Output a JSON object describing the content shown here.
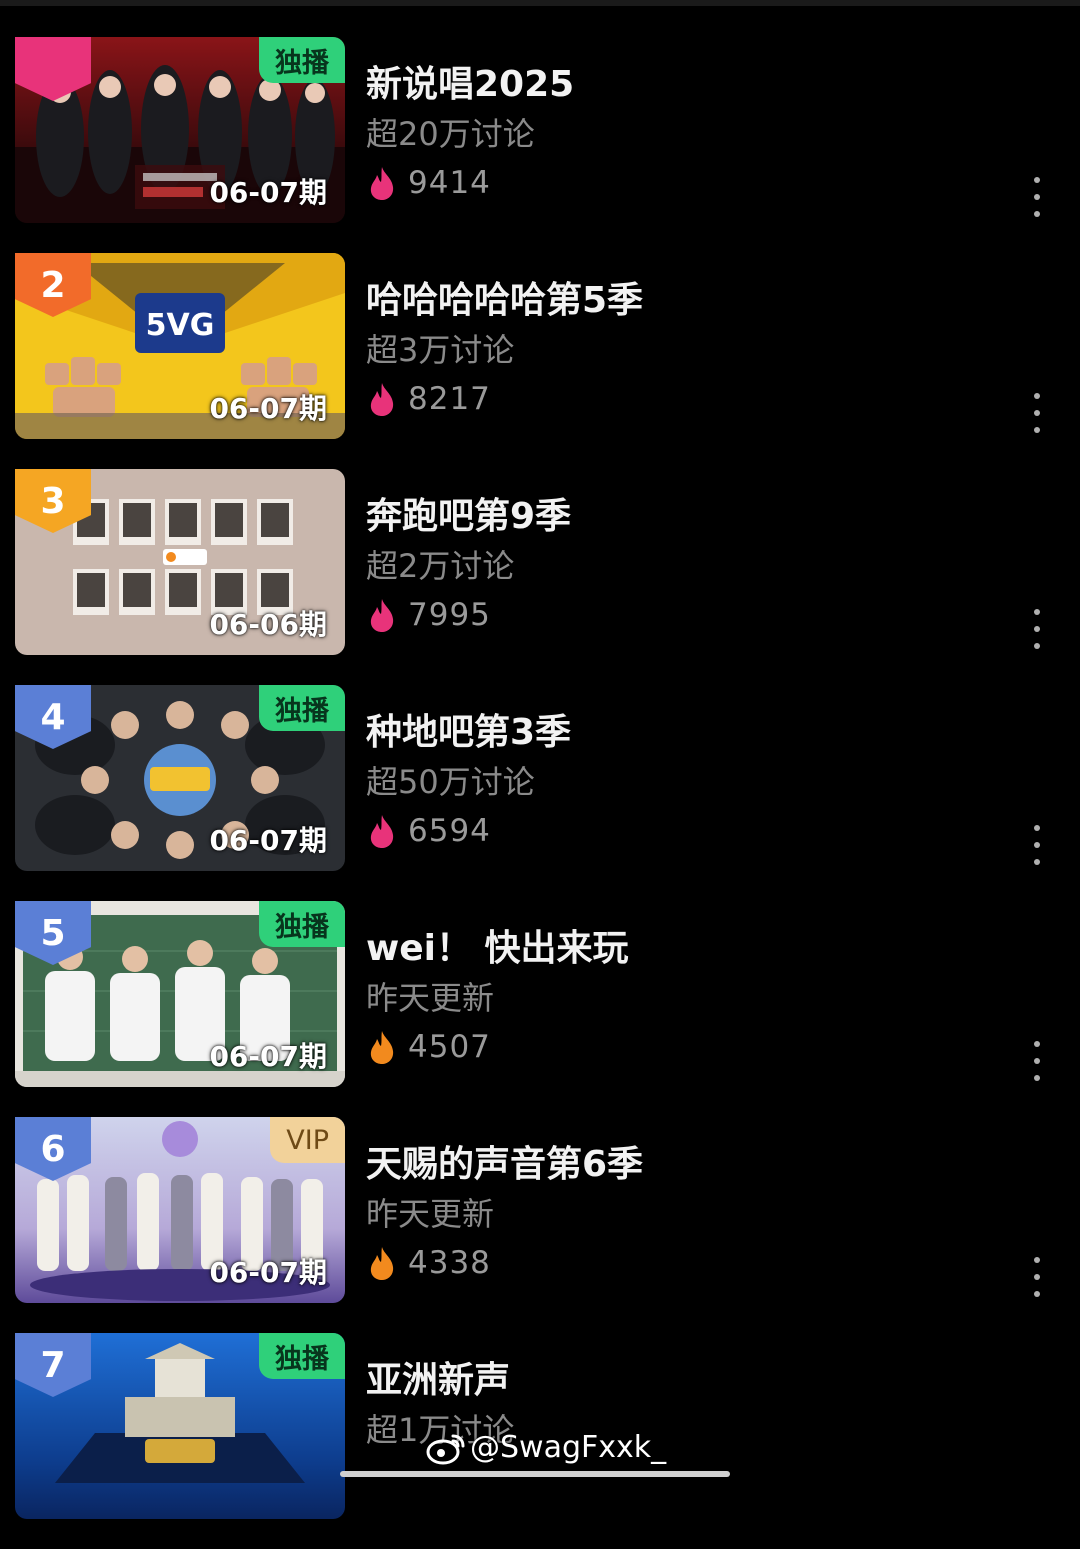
{
  "colors": {
    "background": "#000000",
    "title": "#f2f2f2",
    "subtitle": "#8a8a8a",
    "exclusive_badge": "#2fd07a",
    "vip_badge": "#f2d29a",
    "flame_top": "#e8337a",
    "flame_warm": "#f28a1e"
  },
  "shows": [
    {
      "rank": "",
      "badge": "独播",
      "episode": "06-07期",
      "title": "新说唱2025",
      "subtitle": "超20万讨论",
      "heat": "9414",
      "flame": "pink"
    },
    {
      "rank": "2",
      "badge": "",
      "episode": "06-07期",
      "title": "哈哈哈哈哈第5季",
      "subtitle": "超3万讨论",
      "heat": "8217",
      "flame": "pink"
    },
    {
      "rank": "3",
      "badge": "",
      "episode": "06-06期",
      "title": "奔跑吧第9季",
      "subtitle": "超2万讨论",
      "heat": "7995",
      "flame": "pink"
    },
    {
      "rank": "4",
      "badge": "独播",
      "episode": "06-07期",
      "title": "种地吧第3季",
      "subtitle": "超50万讨论",
      "heat": "6594",
      "flame": "pink"
    },
    {
      "rank": "5",
      "badge": "独播",
      "episode": "06-07期",
      "title": "wei！ 快出来玩",
      "subtitle": "昨天更新",
      "heat": "4507",
      "flame": "orange"
    },
    {
      "rank": "6",
      "badge": "VIP",
      "episode": "06-07期",
      "title": "天赐的声音第6季",
      "subtitle": "昨天更新",
      "heat": "4338",
      "flame": "orange"
    },
    {
      "rank": "7",
      "badge": "独播",
      "episode": "",
      "title": "亚洲新声",
      "subtitle": "超1万讨论",
      "heat": "",
      "flame": "orange"
    }
  ],
  "watermark": {
    "handle": "@SwagFxxk_",
    "icon": "weibo-logo-icon"
  },
  "icons": {
    "more": "more-vertical-icon",
    "heat": "flame-icon"
  }
}
